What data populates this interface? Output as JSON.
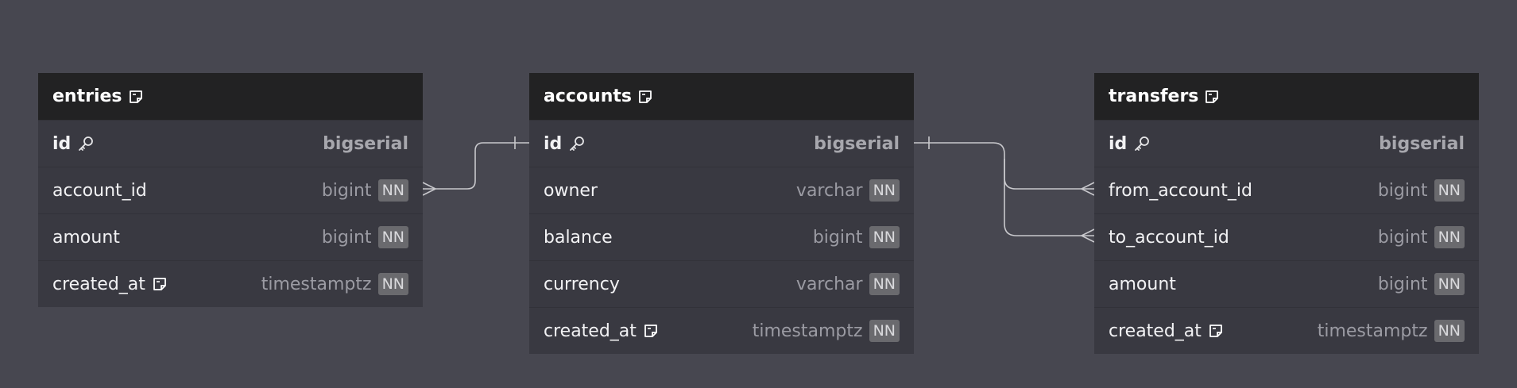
{
  "tables": [
    {
      "name": "entries",
      "columns": [
        {
          "name": "id",
          "type": "bigserial",
          "pk": true,
          "nn": false,
          "note": false
        },
        {
          "name": "account_id",
          "type": "bigint",
          "pk": false,
          "nn": true,
          "note": false
        },
        {
          "name": "amount",
          "type": "bigint",
          "pk": false,
          "nn": true,
          "note": false
        },
        {
          "name": "created_at",
          "type": "timestamptz",
          "pk": false,
          "nn": true,
          "note": true
        }
      ]
    },
    {
      "name": "accounts",
      "columns": [
        {
          "name": "id",
          "type": "bigserial",
          "pk": true,
          "nn": false,
          "note": false
        },
        {
          "name": "owner",
          "type": "varchar",
          "pk": false,
          "nn": true,
          "note": false
        },
        {
          "name": "balance",
          "type": "bigint",
          "pk": false,
          "nn": true,
          "note": false
        },
        {
          "name": "currency",
          "type": "varchar",
          "pk": false,
          "nn": true,
          "note": false
        },
        {
          "name": "created_at",
          "type": "timestamptz",
          "pk": false,
          "nn": true,
          "note": true
        }
      ]
    },
    {
      "name": "transfers",
      "columns": [
        {
          "name": "id",
          "type": "bigserial",
          "pk": true,
          "nn": false,
          "note": false
        },
        {
          "name": "from_account_id",
          "type": "bigint",
          "pk": false,
          "nn": true,
          "note": false
        },
        {
          "name": "to_account_id",
          "type": "bigint",
          "pk": false,
          "nn": true,
          "note": false
        },
        {
          "name": "amount",
          "type": "bigint",
          "pk": false,
          "nn": true,
          "note": false
        },
        {
          "name": "created_at",
          "type": "timestamptz",
          "pk": false,
          "nn": true,
          "note": true
        }
      ]
    }
  ],
  "nn_label": "NN",
  "relationships": [
    {
      "from": "entries.account_id",
      "to": "accounts.id",
      "cardinality": "many-to-one"
    },
    {
      "from": "transfers.from_account_id",
      "to": "accounts.id",
      "cardinality": "many-to-one"
    },
    {
      "from": "transfers.to_account_id",
      "to": "accounts.id",
      "cardinality": "many-to-one"
    }
  ],
  "colors": {
    "background": "#474750",
    "header": "#222223",
    "body": "#393941",
    "connector": "#c8c8cc"
  }
}
